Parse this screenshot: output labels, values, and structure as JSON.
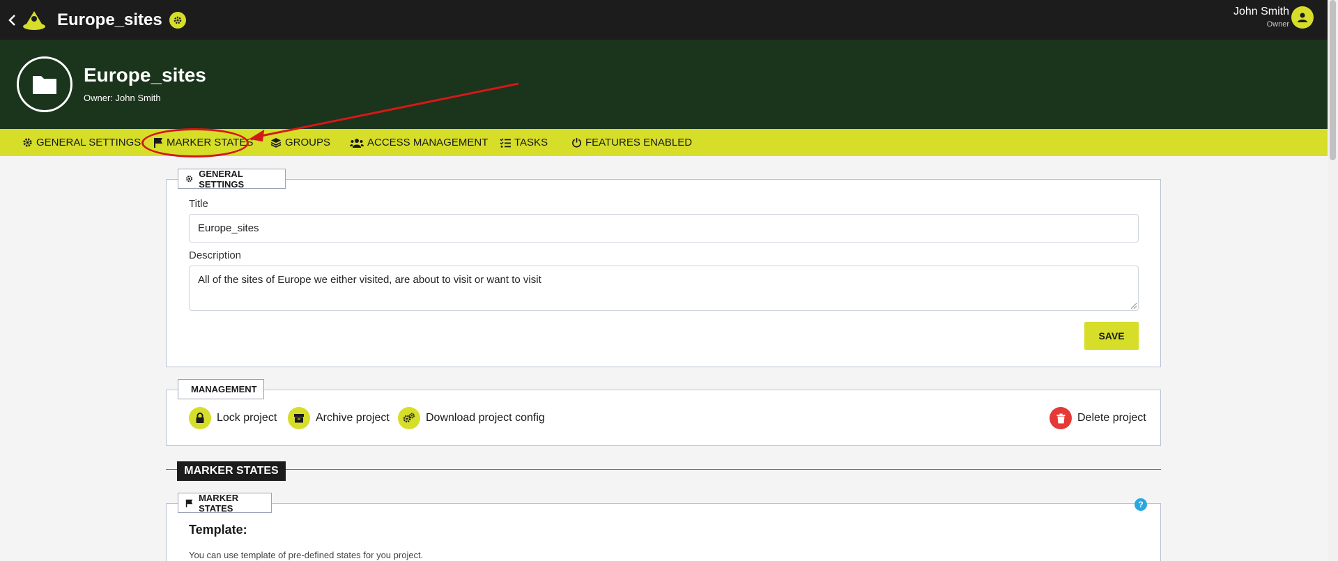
{
  "topbar": {
    "title": "Europe_sites",
    "user_name": "John Smith",
    "user_role": "Owner",
    "icons": [
      "chevron-left-icon",
      "app-logo-icon",
      "gear-icon",
      "user-avatar-icon"
    ]
  },
  "project": {
    "title": "Europe_sites",
    "owner": "Owner: John Smith",
    "icon": "folder-icon"
  },
  "tabs": [
    {
      "label": "GENERAL SETTINGS",
      "icon": "gear-icon"
    },
    {
      "label": "MARKER STATES",
      "icon": "flag-icon"
    },
    {
      "label": "GROUPS",
      "icon": "layers-icon"
    },
    {
      "label": "ACCESS MANAGEMENT",
      "icon": "users-icon"
    },
    {
      "label": "TASKS",
      "icon": "checklist-icon"
    },
    {
      "label": "FEATURES ENABLED",
      "icon": "power-icon"
    }
  ],
  "general_settings": {
    "legend": "GENERAL SETTINGS",
    "title_label": "Title",
    "title_value": "Europe_sites",
    "description_label": "Description",
    "description_value": "All of the sites of Europe we either visited, are about to visit or want to visit",
    "save_label": "SAVE"
  },
  "management": {
    "legend": "MANAGEMENT",
    "lock": "Lock project",
    "archive": "Archive project",
    "download": "Download project config",
    "delete": "Delete project"
  },
  "marker_states": {
    "section_title": "MARKER STATES",
    "legend": "MARKER STATES",
    "help": "?",
    "template_heading": "Template:",
    "template_text": "You can use template of pre-defined states for you project."
  },
  "colors": {
    "accent": "#d6de2a",
    "topbar": "#1c1c1c",
    "header": "#1b341c",
    "danger": "#e53935",
    "annotation": "#d41818"
  }
}
